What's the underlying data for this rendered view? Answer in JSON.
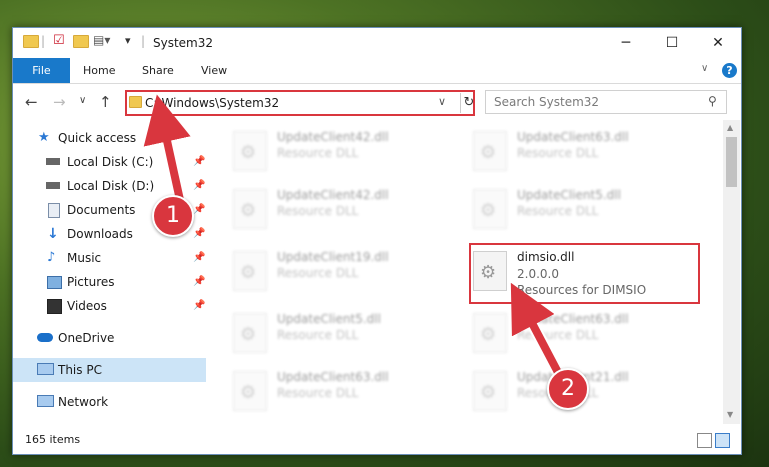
{
  "window": {
    "title": "System32"
  },
  "ribbon": {
    "tabs": [
      "File",
      "Home",
      "Share",
      "View"
    ],
    "help": "?"
  },
  "address": {
    "path": "C:\\Windows\\System32",
    "search_placeholder": "Search System32"
  },
  "sidebar": {
    "items": [
      {
        "label": "Quick access",
        "icon": "star-icon"
      },
      {
        "label": "Local Disk (C:)",
        "icon": "drive-icon",
        "pinned": true
      },
      {
        "label": "Local Disk (D:)",
        "icon": "drive-icon",
        "pinned": true
      },
      {
        "label": "Documents",
        "icon": "documents-icon",
        "pinned": true
      },
      {
        "label": "Downloads",
        "icon": "download-icon",
        "pinned": true
      },
      {
        "label": "Music",
        "icon": "music-icon",
        "pinned": true
      },
      {
        "label": "Pictures",
        "icon": "pictures-icon",
        "pinned": true
      },
      {
        "label": "Videos",
        "icon": "videos-icon",
        "pinned": true
      },
      {
        "label": "OneDrive",
        "icon": "cloud-icon"
      },
      {
        "label": "This PC",
        "icon": "computer-icon",
        "selected": true
      },
      {
        "label": "Network",
        "icon": "network-icon"
      }
    ]
  },
  "files": {
    "blurred": [
      {
        "name": "UpdateClient42.dll",
        "desc": "Resource DLL"
      },
      {
        "name": "UpdateClient63.dll",
        "desc": "Resource DLL"
      },
      {
        "name": "UpdateClient42.dll",
        "desc": "Resource DLL"
      },
      {
        "name": "UpdateClient5.dll",
        "desc": "Resource DLL"
      },
      {
        "name": "UpdateClient19.dll",
        "desc": "Resource DLL"
      },
      {
        "name": "UpdateClient5.dll",
        "desc": "Resource DLL"
      },
      {
        "name": "UpdateClient63.dll",
        "desc": "Resource DLL"
      },
      {
        "name": "UpdateClient63.dll",
        "desc": "Resource DLL"
      },
      {
        "name": "UpdateClient21.dll",
        "desc": "Resource DLL"
      }
    ],
    "highlighted": {
      "name": "dimsio.dll",
      "version": "2.0.0.0",
      "desc": "Resources for DIMSIO"
    }
  },
  "status": {
    "item_count": "165 items"
  },
  "annotations": {
    "step1": "1",
    "step2": "2",
    "color": "#d9363e"
  }
}
